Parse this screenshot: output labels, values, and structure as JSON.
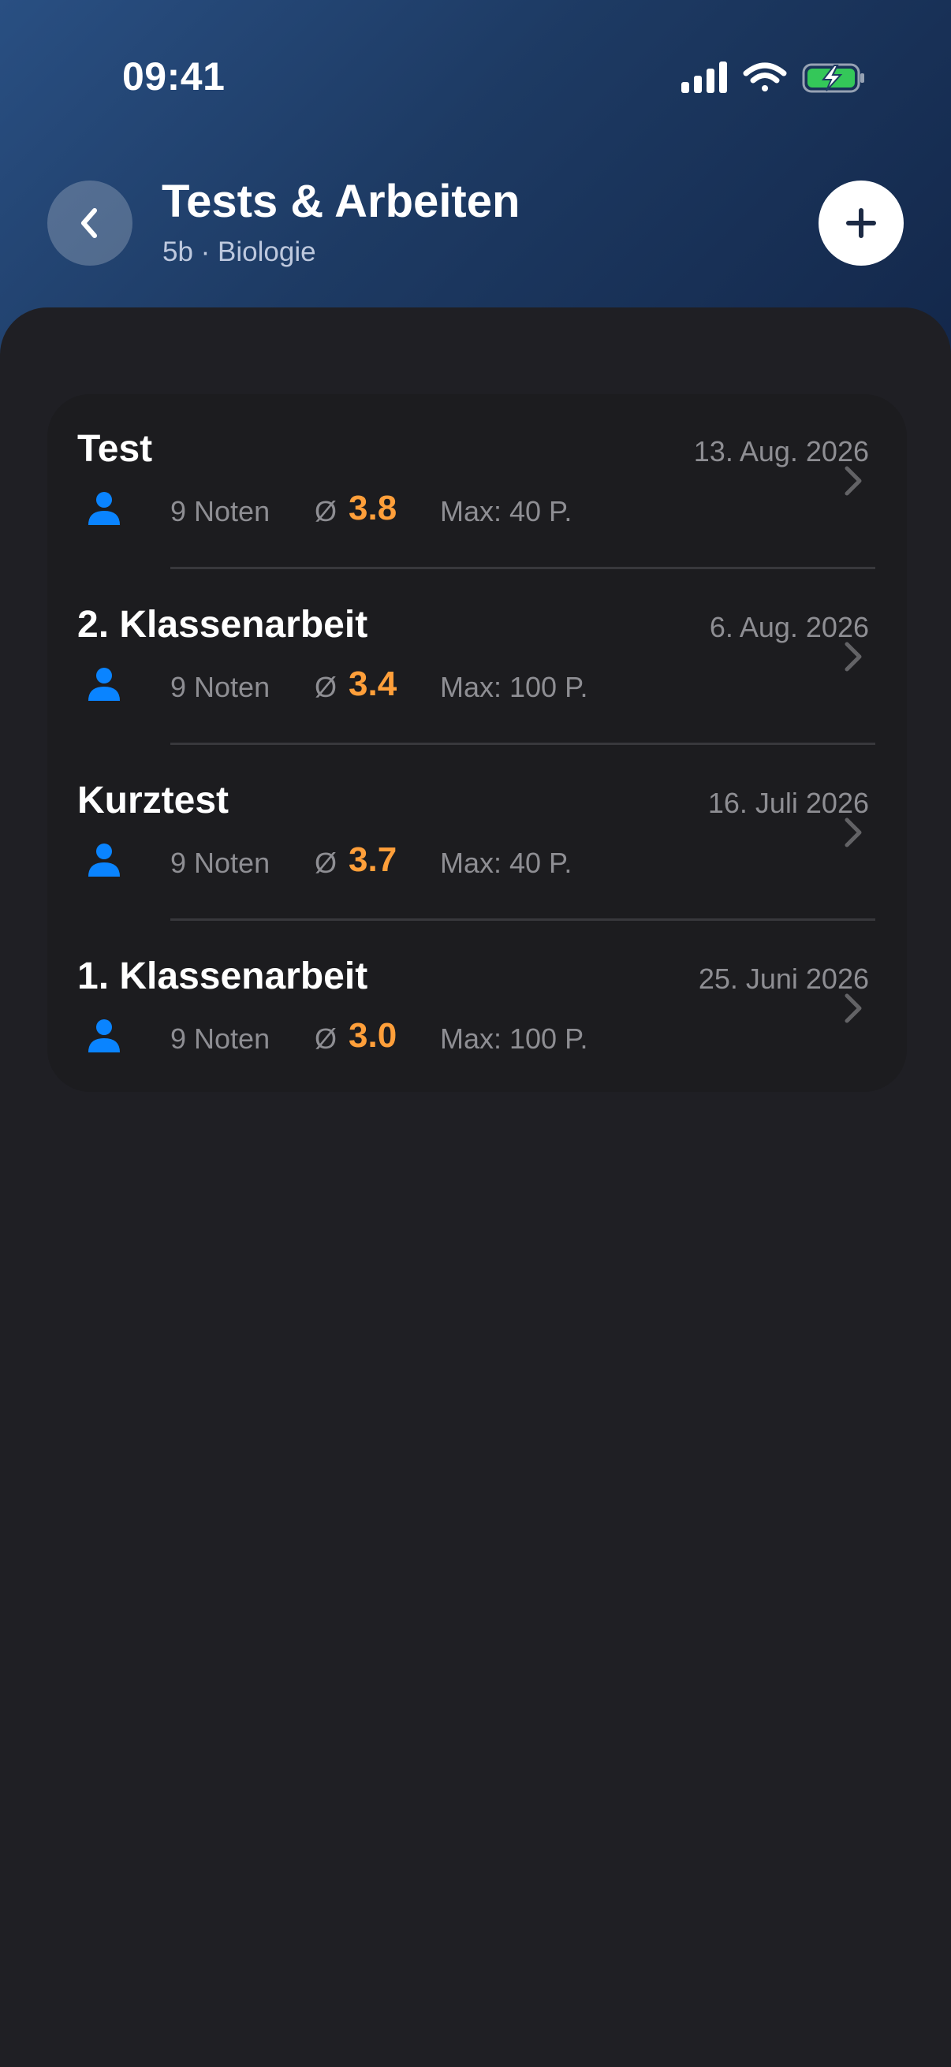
{
  "status_bar": {
    "time": "09:41"
  },
  "header": {
    "title": "Tests & Arbeiten",
    "subtitle": "5b · Biologie",
    "back_icon": "chevron-left-icon",
    "add_icon": "plus-icon"
  },
  "colors": {
    "accent_orange": "#ff9f3a",
    "icon_blue": "#0a84ff",
    "battery_green": "#34c759"
  },
  "tests": [
    {
      "name": "Test",
      "date": "13. Aug. 2026",
      "grades": "9 Noten",
      "avg_symbol": "Ø",
      "avg": "3.8",
      "max": "Max: 40 P."
    },
    {
      "name": "2. Klassenarbeit",
      "date": "6. Aug. 2026",
      "grades": "9 Noten",
      "avg_symbol": "Ø",
      "avg": "3.4",
      "max": "Max: 100 P."
    },
    {
      "name": "Kurztest",
      "date": "16. Juli 2026",
      "grades": "9 Noten",
      "avg_symbol": "Ø",
      "avg": "3.7",
      "max": "Max: 40 P."
    },
    {
      "name": "1. Klassenarbeit",
      "date": "25. Juni 2026",
      "grades": "9 Noten",
      "avg_symbol": "Ø",
      "avg": "3.0",
      "max": "Max: 100 P."
    }
  ]
}
